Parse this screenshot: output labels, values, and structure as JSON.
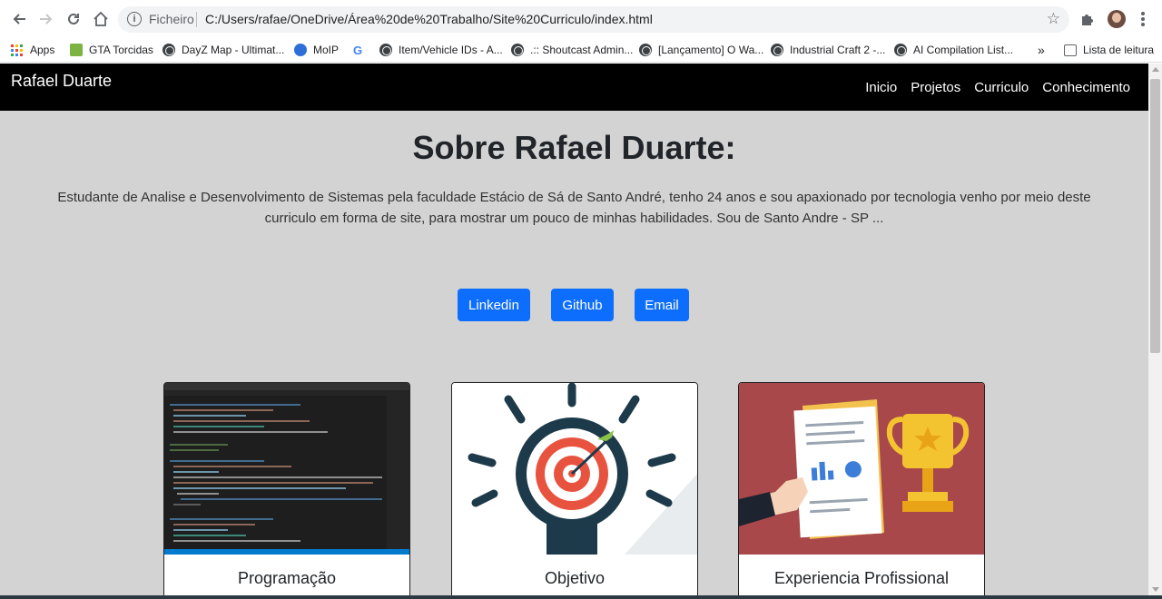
{
  "browser": {
    "scheme_label": "Ficheiro",
    "url": "C:/Users/rafae/OneDrive/Área%20de%20Trabalho/Site%20Curriculo/index.html",
    "bookmarks": [
      {
        "label": "Apps",
        "icon": "apps-grid-icon"
      },
      {
        "label": "GTA Torcidas",
        "icon": "gta-icon"
      },
      {
        "label": "DayZ Map - Ultimat...",
        "icon": "globe-icon"
      },
      {
        "label": "MoIP",
        "icon": "moip-icon"
      },
      {
        "label": "",
        "icon": "google-icon"
      },
      {
        "label": "Item/Vehicle IDs - A...",
        "icon": "globe-icon"
      },
      {
        "label": ".:: Shoutcast Admin...",
        "icon": "globe-icon"
      },
      {
        "label": "[Lançamento] O Wa...",
        "icon": "globe-icon"
      },
      {
        "label": "Industrial Craft 2 -...",
        "icon": "globe-icon"
      },
      {
        "label": "AI Compilation List...",
        "icon": "globe-icon"
      }
    ],
    "more_bookmarks": "»",
    "reading_list": "Lista de leitura"
  },
  "site": {
    "brand": "Rafael Duarte",
    "nav": [
      "Inicio",
      "Projetos",
      "Curriculo",
      "Conhecimento"
    ],
    "title": "Sobre Rafael Duarte:",
    "about": "Estudante de Analise e Desenvolvimento de Sistemas pela faculdade Estácio de Sá de Santo André, tenho 24 anos e sou apaxionado por tecnologia venho por meio deste curriculo em forma de site, para mostrar um pouco de minhas habilidades. Sou de Santo Andre - SP ...",
    "buttons": [
      "Linkedin",
      "Github",
      "Email"
    ],
    "cards": [
      {
        "title": "Programação",
        "image": "code-editor-screenshot"
      },
      {
        "title": "Objetivo",
        "image": "target-lightbulb-illustration"
      },
      {
        "title": "Experiencia Profissional",
        "image": "document-trophy-illustration"
      }
    ]
  },
  "colors": {
    "navbar": "#000000",
    "page_bg": "#d3d3d3",
    "button": "#0d6efd"
  }
}
